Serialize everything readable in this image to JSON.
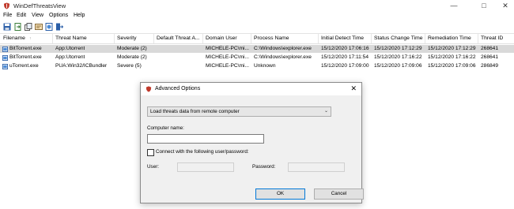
{
  "window": {
    "title": "WinDefThreatsView"
  },
  "menu": [
    "File",
    "Edit",
    "View",
    "Options",
    "Help"
  ],
  "toolbar": [
    "save-icon",
    "export-icon",
    "copy-icon",
    "properties-icon",
    "html-report-icon",
    "exit-icon"
  ],
  "table": {
    "columns": [
      "Filename",
      "Threat Name",
      "Severity",
      "Default Threat A...",
      "Domain User",
      "Process Name",
      "Initial Detect Time",
      "Status Change Time",
      "Remediation Time",
      "Threat ID"
    ],
    "rows": [
      [
        "BitTorrent.exe",
        "App:Utorrent",
        "Moderate (2)",
        "",
        "MICHELE-PC\\mi...",
        "C:\\Windows\\explorer.exe",
        "15/12/2020 17:06:16",
        "15/12/2020 17:12:29",
        "15/12/2020 17:12:29",
        "268641"
      ],
      [
        "BitTorrent.exe",
        "App:Utorrent",
        "Moderate (2)",
        "",
        "MICHELE-PC\\mi...",
        "C:\\Windows\\explorer.exe",
        "15/12/2020 17:11:54",
        "15/12/2020 17:16:22",
        "15/12/2020 17:16:22",
        "268641"
      ],
      [
        "uTorrent.exe",
        "PUA:Win32/ICBundler",
        "Severe (5)",
        "",
        "MICHELE-PC\\mi...",
        "Unknown",
        "15/12/2020 17:09:00",
        "15/12/2020 17:09:06",
        "15/12/2020 17:09:06",
        "286849"
      ]
    ]
  },
  "dialog": {
    "title": "Advanced Options",
    "dropdown_value": "Load threats data from remote computer",
    "computer_name_label": "Computer name:",
    "computer_name_value": "",
    "connect_label": "Connect with the following user/password:",
    "user_label": "User:",
    "password_label": "Password:",
    "ok_label": "OK",
    "cancel_label": "Cancel"
  }
}
